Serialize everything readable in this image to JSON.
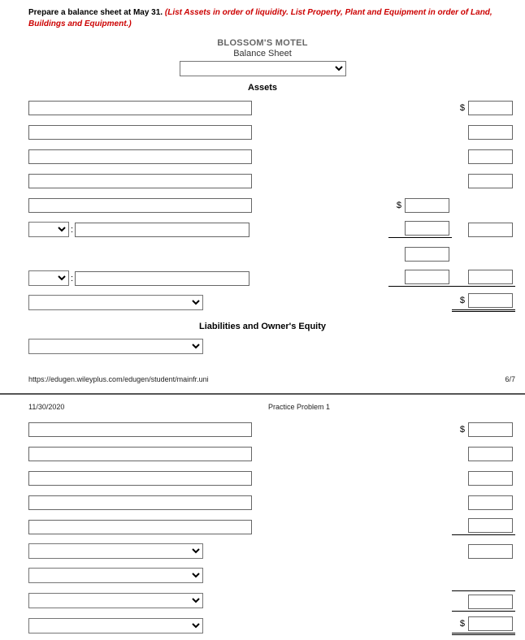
{
  "instruction": {
    "black": "Prepare a balance sheet at May 31. ",
    "red": "(List Assets in order of liquidity. List Property, Plant and Equipment in order of Land, Buildings and Equipment.)"
  },
  "company": "BLOSSOM'S MOTEL",
  "statement_title": "Balance Sheet",
  "date_select_value": "",
  "sections": {
    "assets_header": "Assets",
    "liab_header": "Liabilities and Owner's Equity"
  },
  "currency_symbol": "$",
  "colon": ":",
  "footer": {
    "url": "https://edugen.wileyplus.com/edugen/student/mainfr.uni",
    "page": "6/7"
  },
  "page2": {
    "date": "11/30/2020",
    "title": "Practice Problem 1"
  },
  "values": {
    "assets": {
      "line1": {
        "name": "",
        "amt": ""
      },
      "line2": {
        "name": "",
        "amt": ""
      },
      "line3": {
        "name": "",
        "amt": ""
      },
      "line4": {
        "name": "",
        "amt": ""
      },
      "sub_header": {
        "name": "",
        "mid": ""
      },
      "sub1": {
        "sel": "",
        "name": "",
        "mid": "",
        "amt": ""
      },
      "sub_blank": {
        "mid": ""
      },
      "sub2": {
        "sel": "",
        "name": "",
        "mid": "",
        "amt": ""
      },
      "total": {
        "sel": "",
        "amt": ""
      }
    },
    "liab": {
      "cat_sel": "",
      "line1": {
        "name": "",
        "amt": ""
      },
      "line2": {
        "name": "",
        "amt": ""
      },
      "line3": {
        "name": "",
        "amt": ""
      },
      "line4": {
        "name": "",
        "amt": ""
      },
      "line5": {
        "name": "",
        "amt": ""
      },
      "total1": {
        "sel": "",
        "amt": ""
      },
      "total2": {
        "sel": ""
      },
      "total3": {
        "sel": "",
        "amt": ""
      },
      "grand": {
        "sel": "",
        "amt": ""
      }
    }
  }
}
